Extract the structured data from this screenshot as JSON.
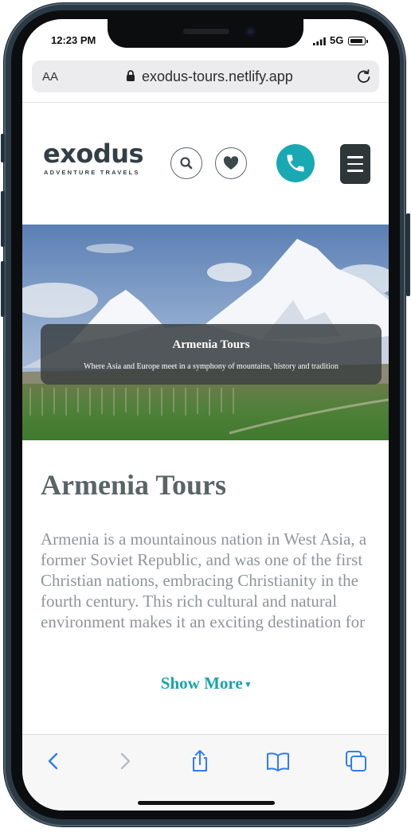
{
  "status_bar": {
    "time": "12:23 PM",
    "network": "5G",
    "signal_icon": "cellular-signal-icon",
    "battery_icon": "battery-icon"
  },
  "browser": {
    "aa_label": "AA",
    "url": "exodus-tours.netlify.app",
    "lock_icon": "lock-icon",
    "reload_icon": "reload-icon"
  },
  "header": {
    "logo_text": "exodus",
    "logo_subtitle": "ADVENTURE TRAVELS",
    "search_icon": "search-icon",
    "favorites_icon": "heart-icon",
    "phone_icon": "phone-icon",
    "menu_icon": "hamburger-menu-icon"
  },
  "hero": {
    "title": "Armenia Tours",
    "subtitle": "Where Asia and Europe meet in a symphony of mountains, history and tradition"
  },
  "main": {
    "title": "Armenia Tours",
    "description": "Armenia is a mountainous nation in West Asia, a former Soviet Republic, and was one of the first Christian nations, embracing Christianity in the fourth century. This rich cultural and natural environment makes it an exciting destination for",
    "show_more_label": "Show More",
    "show_more_icon": "chevron-down-icon"
  },
  "toolbar": {
    "back_icon": "back-arrow-icon",
    "forward_icon": "forward-arrow-icon",
    "share_icon": "share-icon",
    "bookmarks_icon": "bookmarks-icon",
    "tabs_icon": "tabs-icon"
  },
  "colors": {
    "accent": "#19a9b3",
    "dark": "#333f45",
    "text_gray": "#8e9699",
    "title_gray": "#596467",
    "ios_blue": "#2f7cf6"
  }
}
